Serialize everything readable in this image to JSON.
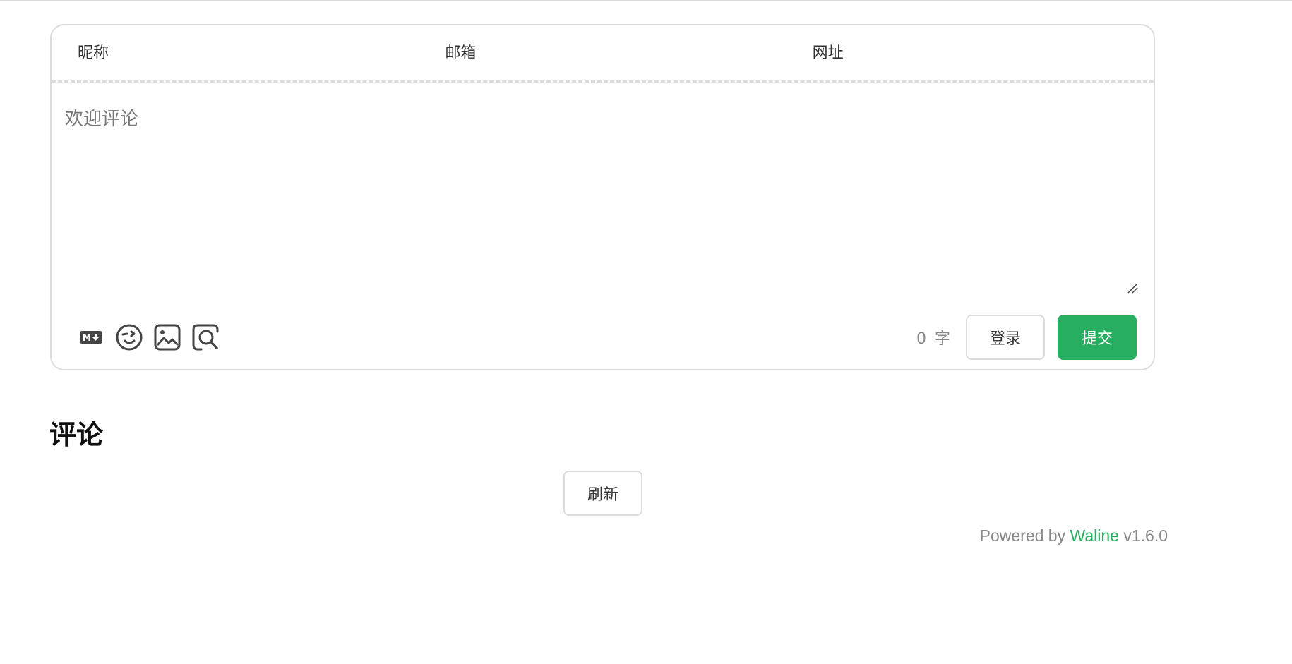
{
  "form": {
    "nick_placeholder": "昵称",
    "mail_placeholder": "邮箱",
    "link_placeholder": "网址",
    "comment_placeholder": "欢迎评论"
  },
  "toolbar": {
    "icons": [
      "markdown-icon",
      "emoji-icon",
      "image-icon",
      "preview-icon"
    ]
  },
  "counter": {
    "value": "0",
    "unit": "字"
  },
  "buttons": {
    "login": "登录",
    "submit": "提交",
    "refresh": "刷新"
  },
  "comments": {
    "title": "评论"
  },
  "footer": {
    "powered_prefix": "Powered by ",
    "brand": "Waline",
    "version": " v1.6.0"
  },
  "colors": {
    "accent": "#27ae60",
    "border": "#dcdcdc",
    "muted": "#888888"
  }
}
